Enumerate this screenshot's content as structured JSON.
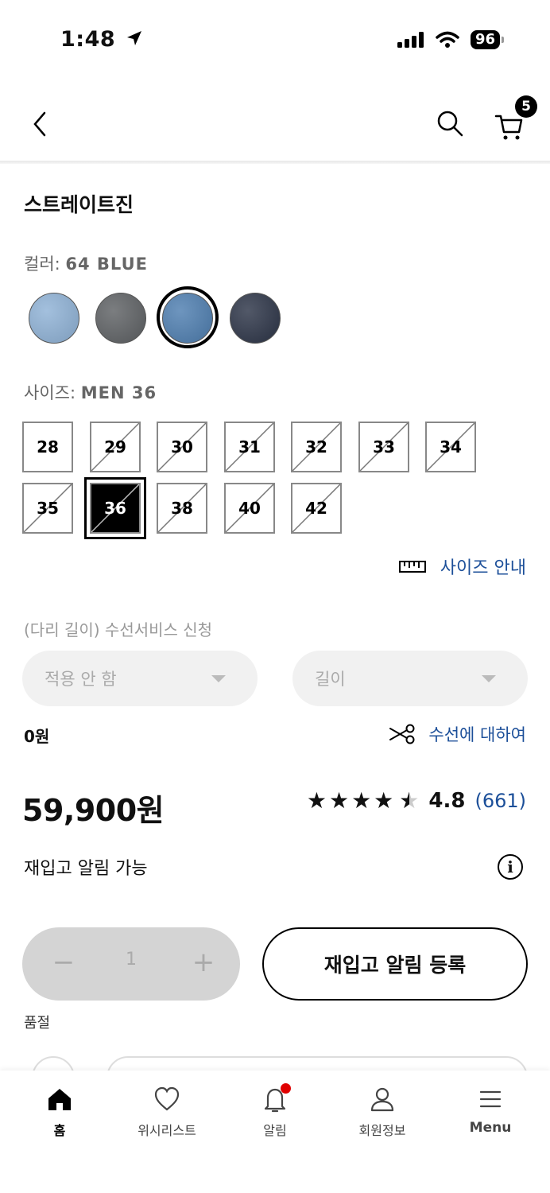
{
  "status": {
    "time": "1:48",
    "battery": "96"
  },
  "header": {
    "cart_count": "5"
  },
  "product": {
    "title": "스트레이트진",
    "color_label": "컬러: ",
    "color_value": "64 BLUE",
    "colors": [
      {
        "name": "light-blue",
        "hex": "#8fb2d6"
      },
      {
        "name": "gray",
        "hex": "#5e6164"
      },
      {
        "name": "blue",
        "hex": "#4e7eb0"
      },
      {
        "name": "navy",
        "hex": "#2c3447"
      }
    ],
    "size_label": "사이즈: ",
    "size_value": "MEN 36",
    "sizes": [
      {
        "label": "28",
        "available": true
      },
      {
        "label": "29",
        "available": false
      },
      {
        "label": "30",
        "available": false
      },
      {
        "label": "31",
        "available": false
      },
      {
        "label": "32",
        "available": false
      },
      {
        "label": "33",
        "available": false
      },
      {
        "label": "34",
        "available": false
      },
      {
        "label": "35",
        "available": false
      },
      {
        "label": "36",
        "available": false,
        "selected": true
      },
      {
        "label": "38",
        "available": false
      },
      {
        "label": "40",
        "available": false
      },
      {
        "label": "42",
        "available": false
      }
    ],
    "size_guide": "사이즈 안내"
  },
  "alteration": {
    "label": "(다리 길이) 수선서비스 신청",
    "select_apply": "적용 안 함",
    "select_length": "길이",
    "price": "0원",
    "info_link": "수선에 대하여"
  },
  "pricing": {
    "price": "59,900원",
    "stars": "★★★★",
    "half_star": "★",
    "rating": "4.8",
    "review_count": "(661)"
  },
  "restock": {
    "text": "재입고 알림 가능",
    "info_icon": "i",
    "button": "재입고 알림 등록"
  },
  "quantity": {
    "minus": "−",
    "value": "1",
    "plus": "+"
  },
  "stock_status": "품절",
  "bottom_nav": {
    "home": "홈",
    "wishlist": "위시리스트",
    "alerts": "알림",
    "member": "회원정보",
    "menu": "Menu"
  },
  "colors": {
    "link": "#1c4f99",
    "notification": "#e00000"
  }
}
